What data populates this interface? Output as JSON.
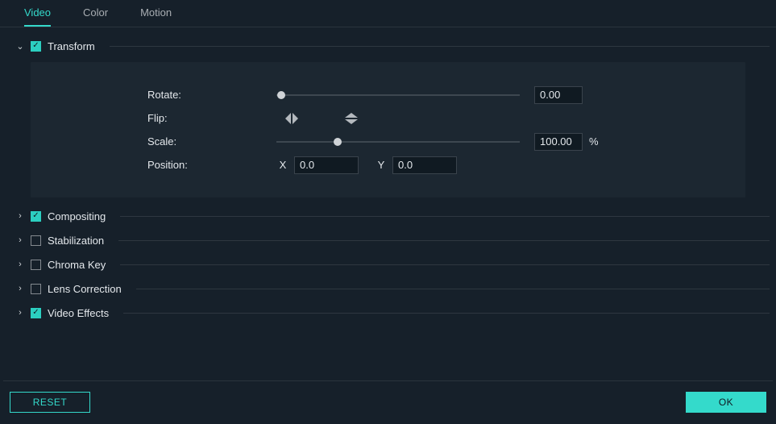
{
  "tabs": {
    "video": "Video",
    "color": "Color",
    "motion": "Motion"
  },
  "sections": {
    "transform": {
      "label": "Transform",
      "checked": true,
      "expanded": true
    },
    "compositing": {
      "label": "Compositing",
      "checked": true,
      "expanded": false
    },
    "stabilization": {
      "label": "Stabilization",
      "checked": false,
      "expanded": false
    },
    "chromaKey": {
      "label": "Chroma Key",
      "checked": false,
      "expanded": false
    },
    "lensCorr": {
      "label": "Lens Correction",
      "checked": false,
      "expanded": false
    },
    "videoFx": {
      "label": "Video Effects",
      "checked": true,
      "expanded": false
    }
  },
  "transform": {
    "rotate_label": "Rotate:",
    "flip_label": "Flip:",
    "scale_label": "Scale:",
    "position_label": "Position:",
    "rotate_value": "0.00",
    "scale_value": "100.00",
    "scale_unit": "%",
    "pos_x_label": "X",
    "pos_y_label": "Y",
    "pos_x_value": "0.0",
    "pos_y_value": "0.0",
    "rotate_slider_pct": 2,
    "scale_slider_pct": 25
  },
  "footer": {
    "reset": "RESET",
    "ok": "OK"
  }
}
